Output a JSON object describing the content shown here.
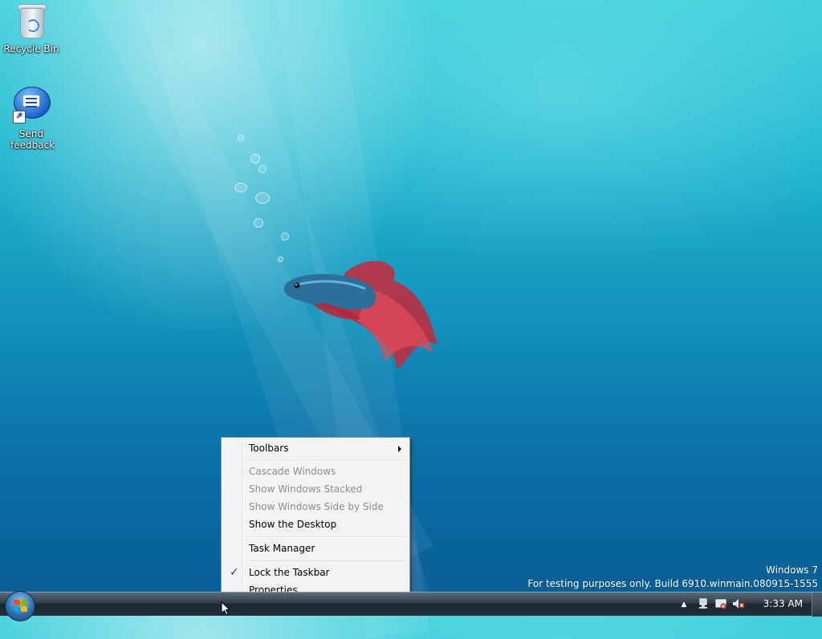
{
  "desktop": {
    "icons": [
      {
        "label": "Recycle Bin",
        "icon": "recycle-bin-icon"
      },
      {
        "label": "Send feedback",
        "icon": "feedback-icon"
      }
    ]
  },
  "context_menu": {
    "items": [
      {
        "label": "Toolbars",
        "enabled": true,
        "submenu": true
      },
      {
        "label": "Cascade Windows",
        "enabled": false
      },
      {
        "label": "Show Windows Stacked",
        "enabled": false
      },
      {
        "label": "Show Windows Side by Side",
        "enabled": false
      },
      {
        "label": "Show the Desktop",
        "enabled": true
      },
      {
        "label": "Task Manager",
        "enabled": true
      },
      {
        "label": "Lock the Taskbar",
        "enabled": true,
        "checked": true
      },
      {
        "label": "Properties",
        "enabled": true
      }
    ]
  },
  "watermark": {
    "line1": "Windows 7",
    "line2": "For testing purposes only. Build 6910.winmain.080915-1555"
  },
  "taskbar": {
    "clock": "3:33 AM",
    "tray_icons": [
      "show-hidden-icons-icon",
      "network-icon",
      "action-center-icon",
      "volume-muted-icon"
    ]
  },
  "colors": {
    "menu_background": "#f3f3f3",
    "disabled_text": "#8d8d8d",
    "check_color": "#1c3f8f"
  }
}
